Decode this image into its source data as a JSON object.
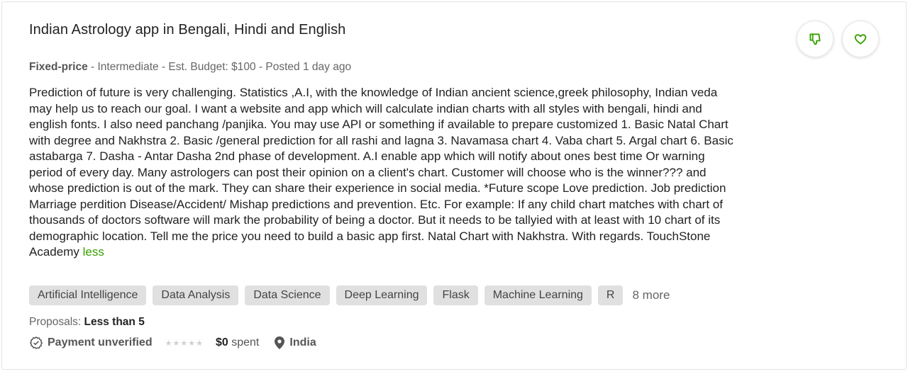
{
  "job": {
    "title": "Indian Astrology app in Bengali, Hindi and English",
    "meta": {
      "type": "Fixed-price",
      "rest": " - Intermediate - Est. Budget: $100 - Posted 1 day ago"
    },
    "description": "Prediction of future is very challenging. Statistics ,A.I, with the knowledge of Indian ancient science,greek philosophy, Indian veda may help us to reach our goal. I want a website and app which will calculate indian charts with all styles with bengali, hindi and english fonts. I also need panchang /panjika. You may use API or something if available to prepare customized 1. Basic Natal Chart with degree and Nakhstra 2. Basic /general prediction for all rashi and lagna 3. Navamasa chart 4. Vaba chart 5. Argal chart 6. Basic astabarga 7. Dasha - Antar Dasha 2nd phase of development. A.I enable app which will notify about ones best time Or warning period of every day. Many astrologers can post their opinion on a client's chart. Customer will choose who is the winner??? and whose prediction is out of the mark. They can share their experience in social media. *Future scope Love prediction. Job prediction Marriage perdition Disease/Accident/ Mishap predictions and prevention. Etc. For example: If any child chart matches with chart of thousands of doctors software will mark the probability of being a doctor. But it needs to be tallyied with at least with 10 chart of its demographic location. Tell me the price you need to build a basic app first. Natal Chart with Nakhstra. With regards. TouchStone Academy ",
    "less_label": "less",
    "skills": [
      "Artificial Intelligence",
      "Data Analysis",
      "Data Science",
      "Deep Learning",
      "Flask",
      "Machine Learning",
      "R"
    ],
    "more_label": "8 more",
    "proposals": {
      "label": "Proposals:",
      "value": "Less than 5"
    },
    "client": {
      "payment": "Payment unverified",
      "rating_stars": 0,
      "spent_amount": "$0",
      "spent_label": "spent",
      "location": "India"
    }
  },
  "colors": {
    "accent": "#37a000",
    "skill_bg": "#e0e0e0"
  },
  "icons": {
    "dislike": "thumbs-down-icon",
    "save": "heart-icon",
    "payment": "check-circle-icon",
    "location": "map-pin-icon"
  }
}
